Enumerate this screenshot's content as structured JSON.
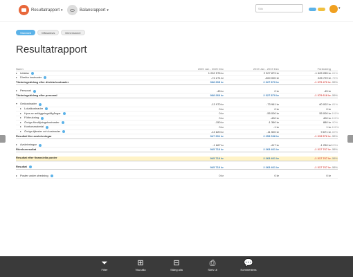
{
  "header": {
    "report1": "Resultatrapport",
    "report2": "Balansrapport",
    "search_placeholder": "Sök",
    "badge1": "",
    "badge2": ""
  },
  "tabs": [
    "Standard",
    "Månadsvis",
    "Dimensioner"
  ],
  "page_title": "Resultatrapport",
  "table": {
    "headers": [
      "Namn",
      "2020 Jan - 2020 Dec",
      "2019 Jan - 2019 Dec",
      "Förändring"
    ],
    "rows": [
      {
        "name": "Intäkter",
        "a": "1 002 576 kr",
        "b": "2 327 879 kr",
        "c": "-1 605 285 kr",
        "p": "-61%",
        "kind": "toggle",
        "info": true
      },
      {
        "name": "Direkta kostnader",
        "a": "-74 271 kr",
        "b": "-300 000 kr",
        "c": "225 729 kr",
        "p": "-75%",
        "kind": "toggle",
        "info": true
      },
      {
        "name": "Täckningsbidrag efter direkta kostnader",
        "a": "968 305 kr",
        "b": "2 327 879 kr",
        "c": "-1 379 470 kr",
        "p": "-59%",
        "kind": "total"
      },
      {
        "kind": "spacer"
      },
      {
        "name": "Personal",
        "a": "-45 kr",
        "b": "0 kr",
        "c": "-45 kr",
        "p": "",
        "kind": "toggle",
        "info": true
      },
      {
        "name": "Täckningsbidrag efter personal",
        "a": "968 260 kr",
        "b": "2 327 879 kr",
        "c": "-1 379 618 kr",
        "p": "-59%",
        "kind": "total"
      },
      {
        "kind": "spacer"
      },
      {
        "name": "Omkostnader",
        "a": "-13 970 kr",
        "b": "-73 961 kr",
        "c": "60 002 kr",
        "p": "-81%",
        "kind": "toggle",
        "info": true
      },
      {
        "name": "Lokalkostnader",
        "a": "0 kr",
        "b": "0 kr",
        "c": "0 kr",
        "p": "",
        "kind": "sub",
        "info": true
      },
      {
        "name": "Hyra av anläggningstillgångar",
        "a": "0 kr",
        "b": "-55 000 kr",
        "c": "55 000 kr",
        "p": "-100%",
        "kind": "sub",
        "info": true
      },
      {
        "name": "Förbrukning",
        "a": "0 kr",
        "b": "-400 kr",
        "c": "400 kr",
        "p": "-100%",
        "kind": "sub",
        "info": true
      },
      {
        "name": "Övriga försäljningskostnader",
        "a": "-150 kr",
        "b": "-1 360 kr",
        "c": "880 kr",
        "p": "-90%",
        "kind": "sub",
        "info": true
      },
      {
        "name": "Kontorsmaterial",
        "a": "0 kr",
        "b": "-1 kr",
        "c": "1 kr",
        "p": "-100%",
        "kind": "sub",
        "info": true
      },
      {
        "name": "Övriga tjänster och kostnader",
        "a": "-13 820 kr",
        "b": "-11 500 kr",
        "c": "9 671 kr",
        "p": "-69%",
        "kind": "sub",
        "info": true
      },
      {
        "name": "Resultat före avskrivningar",
        "a": "947 301 kr",
        "b": "2 253 098 kr",
        "c": "-1 315 576 kr",
        "p": "-56%",
        "kind": "total"
      },
      {
        "kind": "spacer"
      },
      {
        "name": "Avskrivningar",
        "a": "-1 667 kr",
        "b": "-417 kr",
        "c": "-1 250 kr",
        "p": "300%",
        "kind": "toggle",
        "info": true
      },
      {
        "name": "Rörelseresultat",
        "a": "945 710 kr",
        "b": "2 263 461 kr",
        "c": "-1 317 767 kr",
        "p": "-58%",
        "kind": "total"
      },
      {
        "kind": "spacer"
      },
      {
        "name": "Resultat efter finansiella poster",
        "a": "945 710 kr",
        "b": "2 263 461 kr",
        "c": "-1 317 767 kr",
        "p": "-58%",
        "kind": "highlight"
      },
      {
        "kind": "spacer"
      },
      {
        "name": "Resultat",
        "a": "945 710 kr",
        "b": "2 263 461 kr",
        "c": "-1 317 767 kr",
        "p": "-58%",
        "kind": "total",
        "info": true
      },
      {
        "kind": "spacer"
      },
      {
        "name": "Poster under utredning",
        "a": "0 kr",
        "b": "0 kr",
        "c": "0 kr",
        "p": "",
        "kind": "toggle",
        "info": true
      }
    ]
  },
  "bottombar": [
    {
      "label": "Filter",
      "icon": "filter-icon",
      "glyph": "⏷"
    },
    {
      "label": "Visa alla",
      "icon": "expand-icon",
      "glyph": "⊞"
    },
    {
      "label": "Stäng alla",
      "icon": "collapse-icon",
      "glyph": "⊟"
    },
    {
      "label": "Skriv ut",
      "icon": "print-icon",
      "glyph": "⎙"
    },
    {
      "label": "Kommentera",
      "icon": "comment-icon",
      "glyph": "💬"
    }
  ],
  "colors": {
    "accent": "#5bb2e8",
    "positive": "#357ab7",
    "negative": "#d9534f",
    "highlight": "#fff3c7",
    "bar": "#3a3a3a"
  }
}
